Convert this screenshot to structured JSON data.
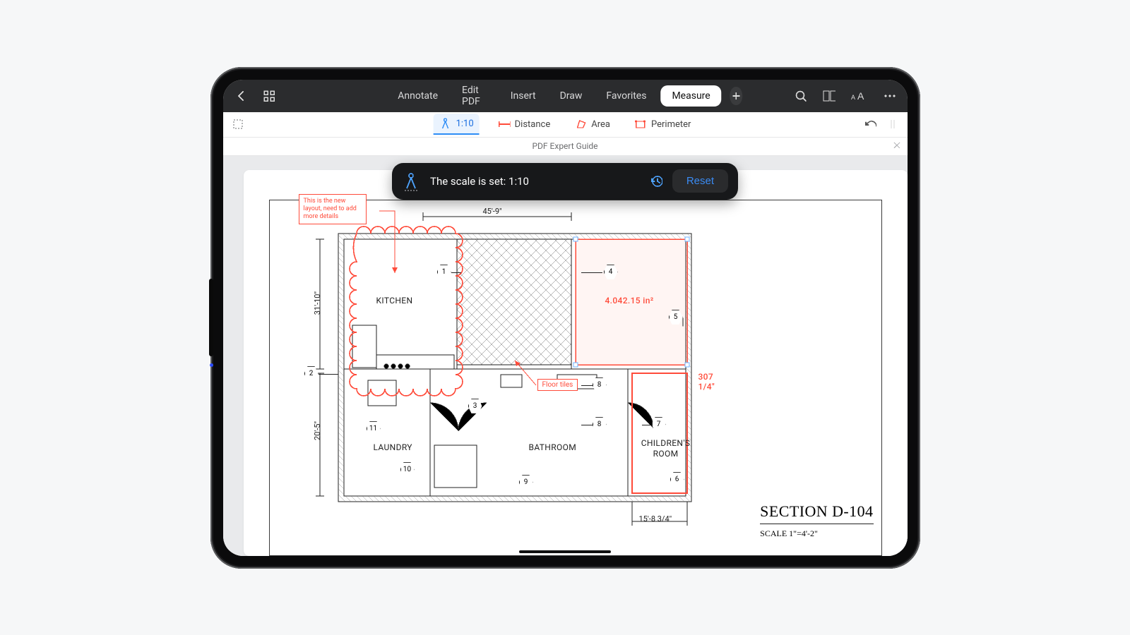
{
  "title": "PDF Expert Guide",
  "tabs": {
    "annotate": "Annotate",
    "editpdf": "Edit PDF",
    "insert": "Insert",
    "draw": "Draw",
    "favorites": "Favorites",
    "measure": "Measure"
  },
  "subbar": {
    "scale_label": "1:10",
    "distance": "Distance",
    "area": "Area",
    "perimeter": "Perimeter"
  },
  "hud": {
    "message": "The scale is set: 1:10",
    "reset": "Reset"
  },
  "plan": {
    "note_text": "This is the new layout, need to add more details",
    "rooms": {
      "kitchen": "KITCHEN",
      "laundry": "LAUNDRY",
      "bathroom": "BATHROOM",
      "children": "CHILDREN'S ROOM"
    },
    "floor_tiles_label": "Floor tiles",
    "area_measure": "4.042.15 in²",
    "perimeter_measure": "307 1/4\"",
    "callouts": {
      "c1": "1",
      "c2": "2",
      "c4": "4",
      "c5": "5",
      "c6": "6",
      "c7": "7",
      "c8a": "8",
      "c8b": "8",
      "c9": "9",
      "c10": "10",
      "c11": "11",
      "c3": "3"
    },
    "dimensions": {
      "top": "45'-9\"",
      "leftTop": "31'-10\"",
      "leftBottom": "20'-5\"",
      "bottom": "15'-8 3/4\""
    },
    "titleblock": {
      "big": "SECTION D-104",
      "small": "SCALE 1\"=4'-2\""
    }
  }
}
